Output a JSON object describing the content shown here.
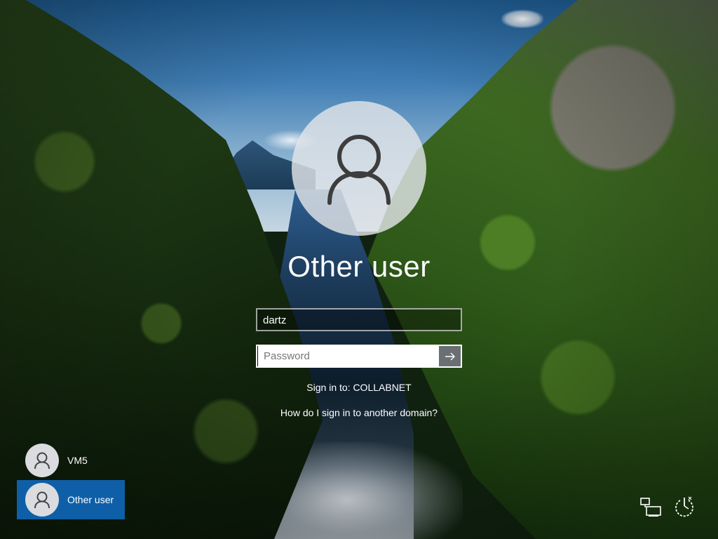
{
  "screen": {
    "title": "Other user"
  },
  "login": {
    "username_value": "dartz",
    "password_placeholder": "Password",
    "sign_in_to": "Sign in to: COLLABNET",
    "domain_help_link": "How do I sign in to another domain?",
    "submit_icon": "arrow-right-icon"
  },
  "user_list": [
    {
      "label": "VM5",
      "icon": "user-icon",
      "selected": false
    },
    {
      "label": "Other user",
      "icon": "user-icon",
      "selected": true
    }
  ],
  "corner_icons": {
    "network": "network-icon",
    "power": "power-icon"
  },
  "colors": {
    "selected_tile": "#0e5fa8",
    "submit_button": "#6a6f73"
  }
}
